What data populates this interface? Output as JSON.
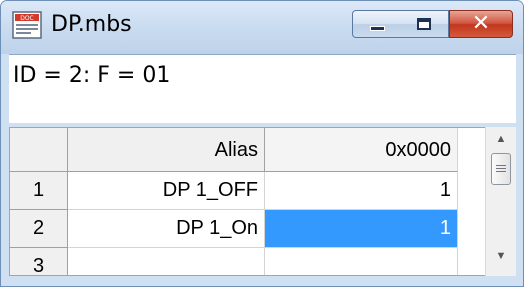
{
  "window": {
    "title": "DP.mbs",
    "icon": "mbs-document-icon"
  },
  "caption_buttons": {
    "minimize": "minimize-icon",
    "maximize": "maximize-icon",
    "close": "close-icon",
    "close_glyph": "✕"
  },
  "info": {
    "text": "ID = 2: F = 01"
  },
  "table": {
    "headers": [
      "",
      "Alias",
      "0x0000"
    ],
    "rows": [
      {
        "index": "1",
        "alias": "DP 1_OFF",
        "value": "1",
        "selected": false
      },
      {
        "index": "2",
        "alias": "DP 1_On",
        "value": "1",
        "selected": true
      },
      {
        "index": "3",
        "alias": "",
        "value": "",
        "selected": false
      }
    ]
  },
  "colors": {
    "selection": "#3399ff",
    "close_button": "#c2361d"
  }
}
